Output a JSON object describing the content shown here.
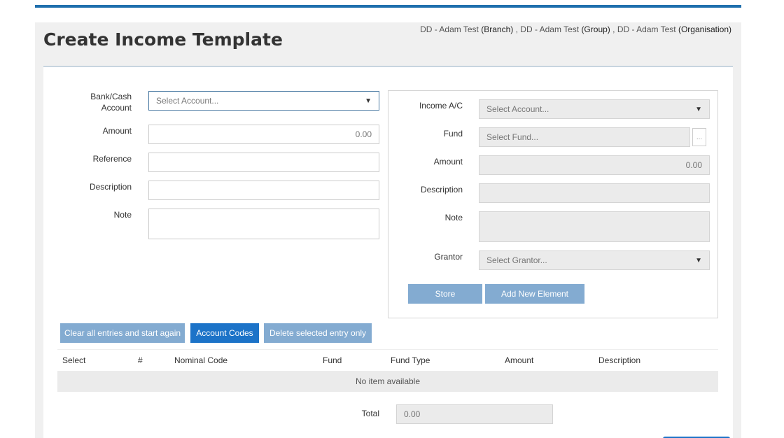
{
  "header": {
    "title": "Create Income Template",
    "org": {
      "branch_name": "DD - Adam Test",
      "branch_tag": "(Branch)",
      "sep1": ",",
      "group_name": "DD - Adam Test",
      "group_tag": "(Group)",
      "sep2": ",",
      "org_name": "DD - Adam Test",
      "org_tag": "(Organisation)"
    }
  },
  "left_form": {
    "bank_label_line1": "Bank/Cash",
    "bank_label_line2": "Account",
    "bank_placeholder": "Select Account...",
    "amount_label": "Amount",
    "amount_value": "0.00",
    "reference_label": "Reference",
    "reference_value": "",
    "description_label": "Description",
    "description_value": "",
    "note_label": "Note",
    "note_value": ""
  },
  "right_form": {
    "income_label": "Income A/C",
    "income_placeholder": "Select Account...",
    "fund_label": "Fund",
    "fund_placeholder": "Select Fund...",
    "fund_ellipsis": "...",
    "amount_label": "Amount",
    "amount_value": "0.00",
    "description_label": "Description",
    "note_label": "Note",
    "grantor_label": "Grantor",
    "grantor_placeholder": "Select Grantor...",
    "store_label": "Store",
    "add_element_label": "Add New Element"
  },
  "actions": {
    "clear_label": "Clear all entries and start again",
    "account_codes_label": "Account Codes",
    "delete_label": "Delete selected entry only"
  },
  "table": {
    "columns": [
      "Select",
      "#",
      "Nominal Code",
      "Fund",
      "Fund Type",
      "Amount",
      "Description"
    ],
    "empty_text": "No item available"
  },
  "total": {
    "label": "Total",
    "value": "0.00"
  },
  "colors": {
    "accent": "#1f6fad",
    "primary_button": "#1c73c8",
    "muted_button": "#83abd1"
  }
}
